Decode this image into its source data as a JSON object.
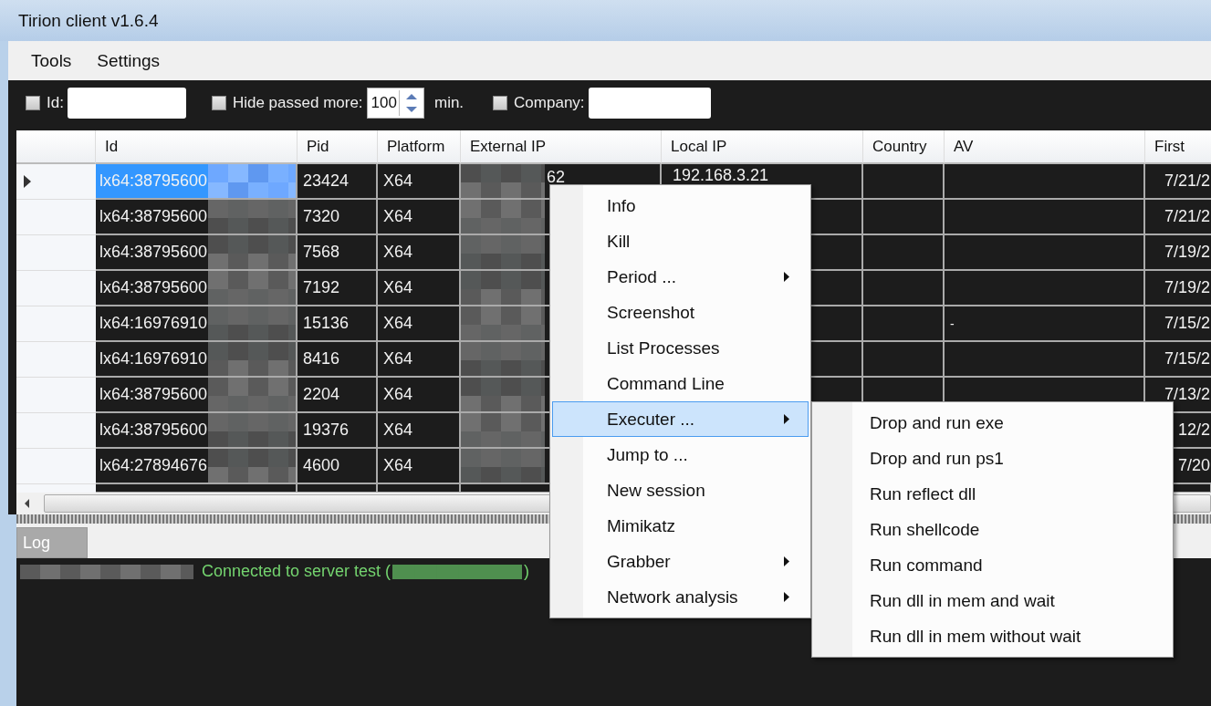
{
  "window": {
    "title": "Tirion client v1.6.4"
  },
  "menu": [
    "Tools",
    "Settings"
  ],
  "filters": {
    "id": {
      "label": "Id:",
      "checked": false
    },
    "hide": {
      "label": "Hide passed more:",
      "checked": false,
      "value": "100",
      "unit": "min."
    },
    "company": {
      "label": "Company:",
      "checked": false
    }
  },
  "table": {
    "columns": [
      "Id",
      "Pid",
      "Platform",
      "External IP",
      "Local IP",
      "Country",
      "AV",
      "First"
    ],
    "rows": [
      {
        "id": "lx64:38795600",
        "pid": "23424",
        "platform": "X64",
        "external_ip": "62",
        "local_ip": "192.168.3.21",
        "first": "7/21/2",
        "selected": true
      },
      {
        "id": "lx64:38795600",
        "pid": "7320",
        "platform": "X64",
        "first": "7/21/2",
        "selected": false
      },
      {
        "id": "lx64:38795600",
        "pid": "7568",
        "platform": "X64",
        "first": "7/19/2",
        "selected": false
      },
      {
        "id": "lx64:38795600",
        "pid": "7192",
        "platform": "X64",
        "first": "7/19/2",
        "selected": false
      },
      {
        "id": "lx64:16976910",
        "pid": "15136",
        "platform": "X64",
        "av": "-",
        "first": "7/15/2",
        "selected": false
      },
      {
        "id": "lx64:16976910",
        "pid": "8416",
        "platform": "X64",
        "first": "7/15/2",
        "selected": false
      },
      {
        "id": "lx64:38795600",
        "pid": "2204",
        "platform": "X64",
        "first": "7/13/2",
        "selected": false
      },
      {
        "id": "lx64:38795600",
        "pid": "19376",
        "platform": "X64",
        "first": "12/2",
        "selected": false
      },
      {
        "id": "lx64:27894676",
        "pid": "4600",
        "platform": "X64",
        "first": "7/20",
        "selected": false
      }
    ]
  },
  "log": {
    "tab": "Log",
    "entries": [
      {
        "text": "Connected to server test (",
        "close": ")"
      }
    ]
  },
  "context_menu": [
    {
      "label": "Info",
      "submenu": false,
      "selected": false
    },
    {
      "label": "Kill",
      "submenu": false,
      "selected": false
    },
    {
      "label": "Period ...",
      "submenu": true,
      "selected": false
    },
    {
      "label": "Screenshot",
      "submenu": false,
      "selected": false
    },
    {
      "label": "List Processes",
      "submenu": false,
      "selected": false
    },
    {
      "label": "Command Line",
      "submenu": false,
      "selected": false
    },
    {
      "label": "Executer ...",
      "submenu": true,
      "selected": true
    },
    {
      "label": "Jump to ...",
      "submenu": false,
      "selected": false
    },
    {
      "label": "New session",
      "submenu": false,
      "selected": false
    },
    {
      "label": "Mimikatz",
      "submenu": false,
      "selected": false
    },
    {
      "label": "Grabber",
      "submenu": true,
      "selected": false
    },
    {
      "label": "Network analysis",
      "submenu": true,
      "selected": false
    }
  ],
  "submenu": [
    "Drop and run exe",
    "Drop and run ps1",
    "Run reflect dll",
    "Run shellcode",
    "Run command",
    "Run dll in mem and wait",
    "Run dll in mem without wait"
  ]
}
